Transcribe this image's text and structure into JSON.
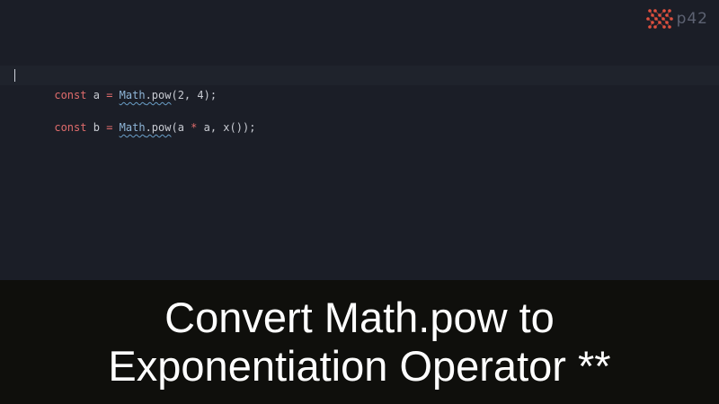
{
  "brand": {
    "logo_text": "p42",
    "logo_icon": "p42-network-icon",
    "accent_color": "#e0503f"
  },
  "editor": {
    "lines": [
      {
        "keyword": "const",
        "var": "a",
        "op": "=",
        "fn_obj": "Math",
        "fn_rest": ".pow",
        "args": "(2, 4);"
      },
      {
        "keyword": "const",
        "var": "b",
        "op": "=",
        "fn_obj": "Math",
        "fn_rest": ".pow",
        "args_open": "(a ",
        "args_op": "*",
        "args_close": " a, x());"
      }
    ]
  },
  "caption": {
    "line1": "Convert Math.pow to",
    "line2": "Exponentiation Operator **"
  }
}
